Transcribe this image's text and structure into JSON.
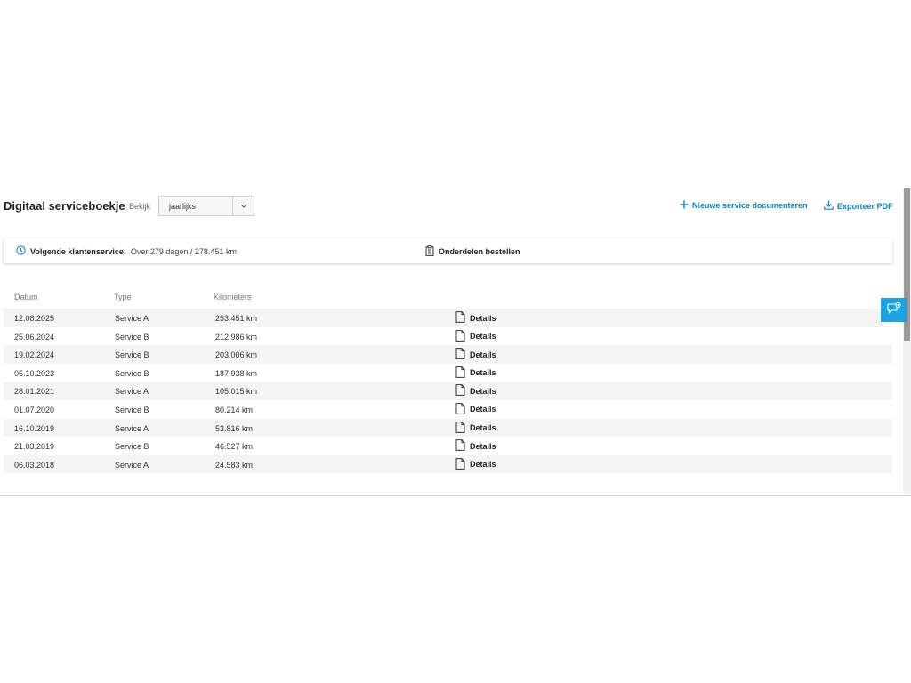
{
  "header": {
    "title": "Digitaal serviceboekje",
    "view_label": "Bekijk",
    "view_select_value": "jaarlijks",
    "actions": {
      "new_service": "Nieuwe service documenteren",
      "export_pdf": "Exporteer PDF"
    }
  },
  "info_bar": {
    "next_service_label": "Volgende klantenservice:",
    "next_service_value": "Over 279 dagen / 278.451 km",
    "order_parts": "Onderdelen bestellen"
  },
  "table": {
    "headers": {
      "date": "Datum",
      "type": "Type",
      "km": "Kilometers"
    },
    "details_label": "Details",
    "rows": [
      {
        "date": "12.08.2025",
        "type": "Service A",
        "km": "253.451 km"
      },
      {
        "date": "25.06.2024",
        "type": "Service B",
        "km": "212.986 km"
      },
      {
        "date": "19.02.2024",
        "type": "Service B",
        "km": "203.006 km"
      },
      {
        "date": "05.10.2023",
        "type": "Service B",
        "km": "187.938 km"
      },
      {
        "date": "28.01.2021",
        "type": "Service A",
        "km": "105.015 km"
      },
      {
        "date": "01.07.2020",
        "type": "Service B",
        "km": "80.214 km"
      },
      {
        "date": "16.10.2019",
        "type": "Service A",
        "km": "53.816 km"
      },
      {
        "date": "21.03.2019",
        "type": "Service B",
        "km": "46.527 km"
      },
      {
        "date": "06.03.2018",
        "type": "Service A",
        "km": "24.583 km"
      }
    ]
  },
  "colors": {
    "accent": "#0b84c7",
    "feedback_button": "#1aa3e0",
    "row_stripe": "#f4f4f4"
  },
  "icons": {
    "select": "chevron-down-icon",
    "new_service": "plus-icon",
    "export_pdf": "download-icon",
    "next_service": "clock-icon",
    "order_parts": "clipboard-icon",
    "details": "document-icon",
    "feedback": "feedback-icon"
  }
}
